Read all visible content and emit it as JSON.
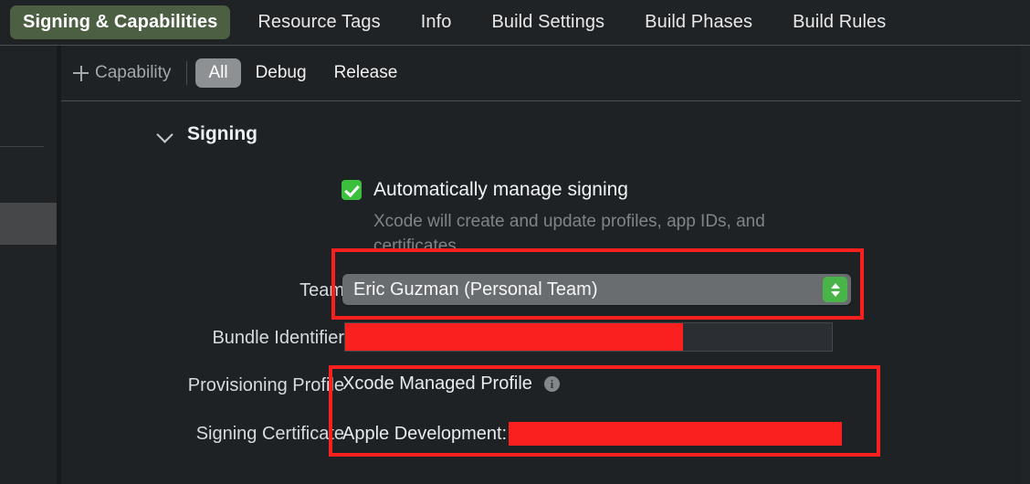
{
  "tabs": [
    {
      "label": "Signing & Capabilities",
      "active": true
    },
    {
      "label": "Resource Tags",
      "active": false
    },
    {
      "label": "Info",
      "active": false
    },
    {
      "label": "Build Settings",
      "active": false
    },
    {
      "label": "Build Phases",
      "active": false
    },
    {
      "label": "Build Rules",
      "active": false
    }
  ],
  "toolbar": {
    "add_capability_label": "Capability",
    "add_capability_icon": "plus-icon",
    "configurations": [
      {
        "label": "All",
        "selected": true
      },
      {
        "label": "Debug",
        "selected": false
      },
      {
        "label": "Release",
        "selected": false
      }
    ]
  },
  "section": {
    "title": "Signing",
    "disclosure_icon": "chevron-down-icon",
    "expanded": true
  },
  "signing": {
    "auto_manage": {
      "label": "Automatically manage signing",
      "checked": true,
      "help_text": "Xcode will create and update profiles, app IDs, and certificates."
    },
    "team": {
      "label": "Team",
      "value": "Eric Guzman (Personal Team)",
      "stepper_icon": "up-down-chevron-icon"
    },
    "bundle_identifier": {
      "label": "Bundle Identifier",
      "value": "",
      "redacted": true
    },
    "provisioning_profile": {
      "label": "Provisioning Profile",
      "value": "Xcode Managed Profile",
      "info_icon": "info-icon",
      "info_glyph": "i"
    },
    "signing_certificate": {
      "label": "Signing Certificate",
      "value": "Apple Development:",
      "redacted": true
    }
  },
  "annotations": {
    "color": "#fb2020",
    "boxes": [
      {
        "name": "team-highlight"
      },
      {
        "name": "profile-certificate-highlight"
      }
    ]
  },
  "colors": {
    "background": "#1e2225",
    "tab_active": "#4d5f43",
    "segment_selected": "#8e9194",
    "checkbox_green": "#3cbf3c",
    "stepper_green": "#49b549",
    "redaction_red": "#fb2020",
    "popup_gray": "#6a6d70"
  }
}
